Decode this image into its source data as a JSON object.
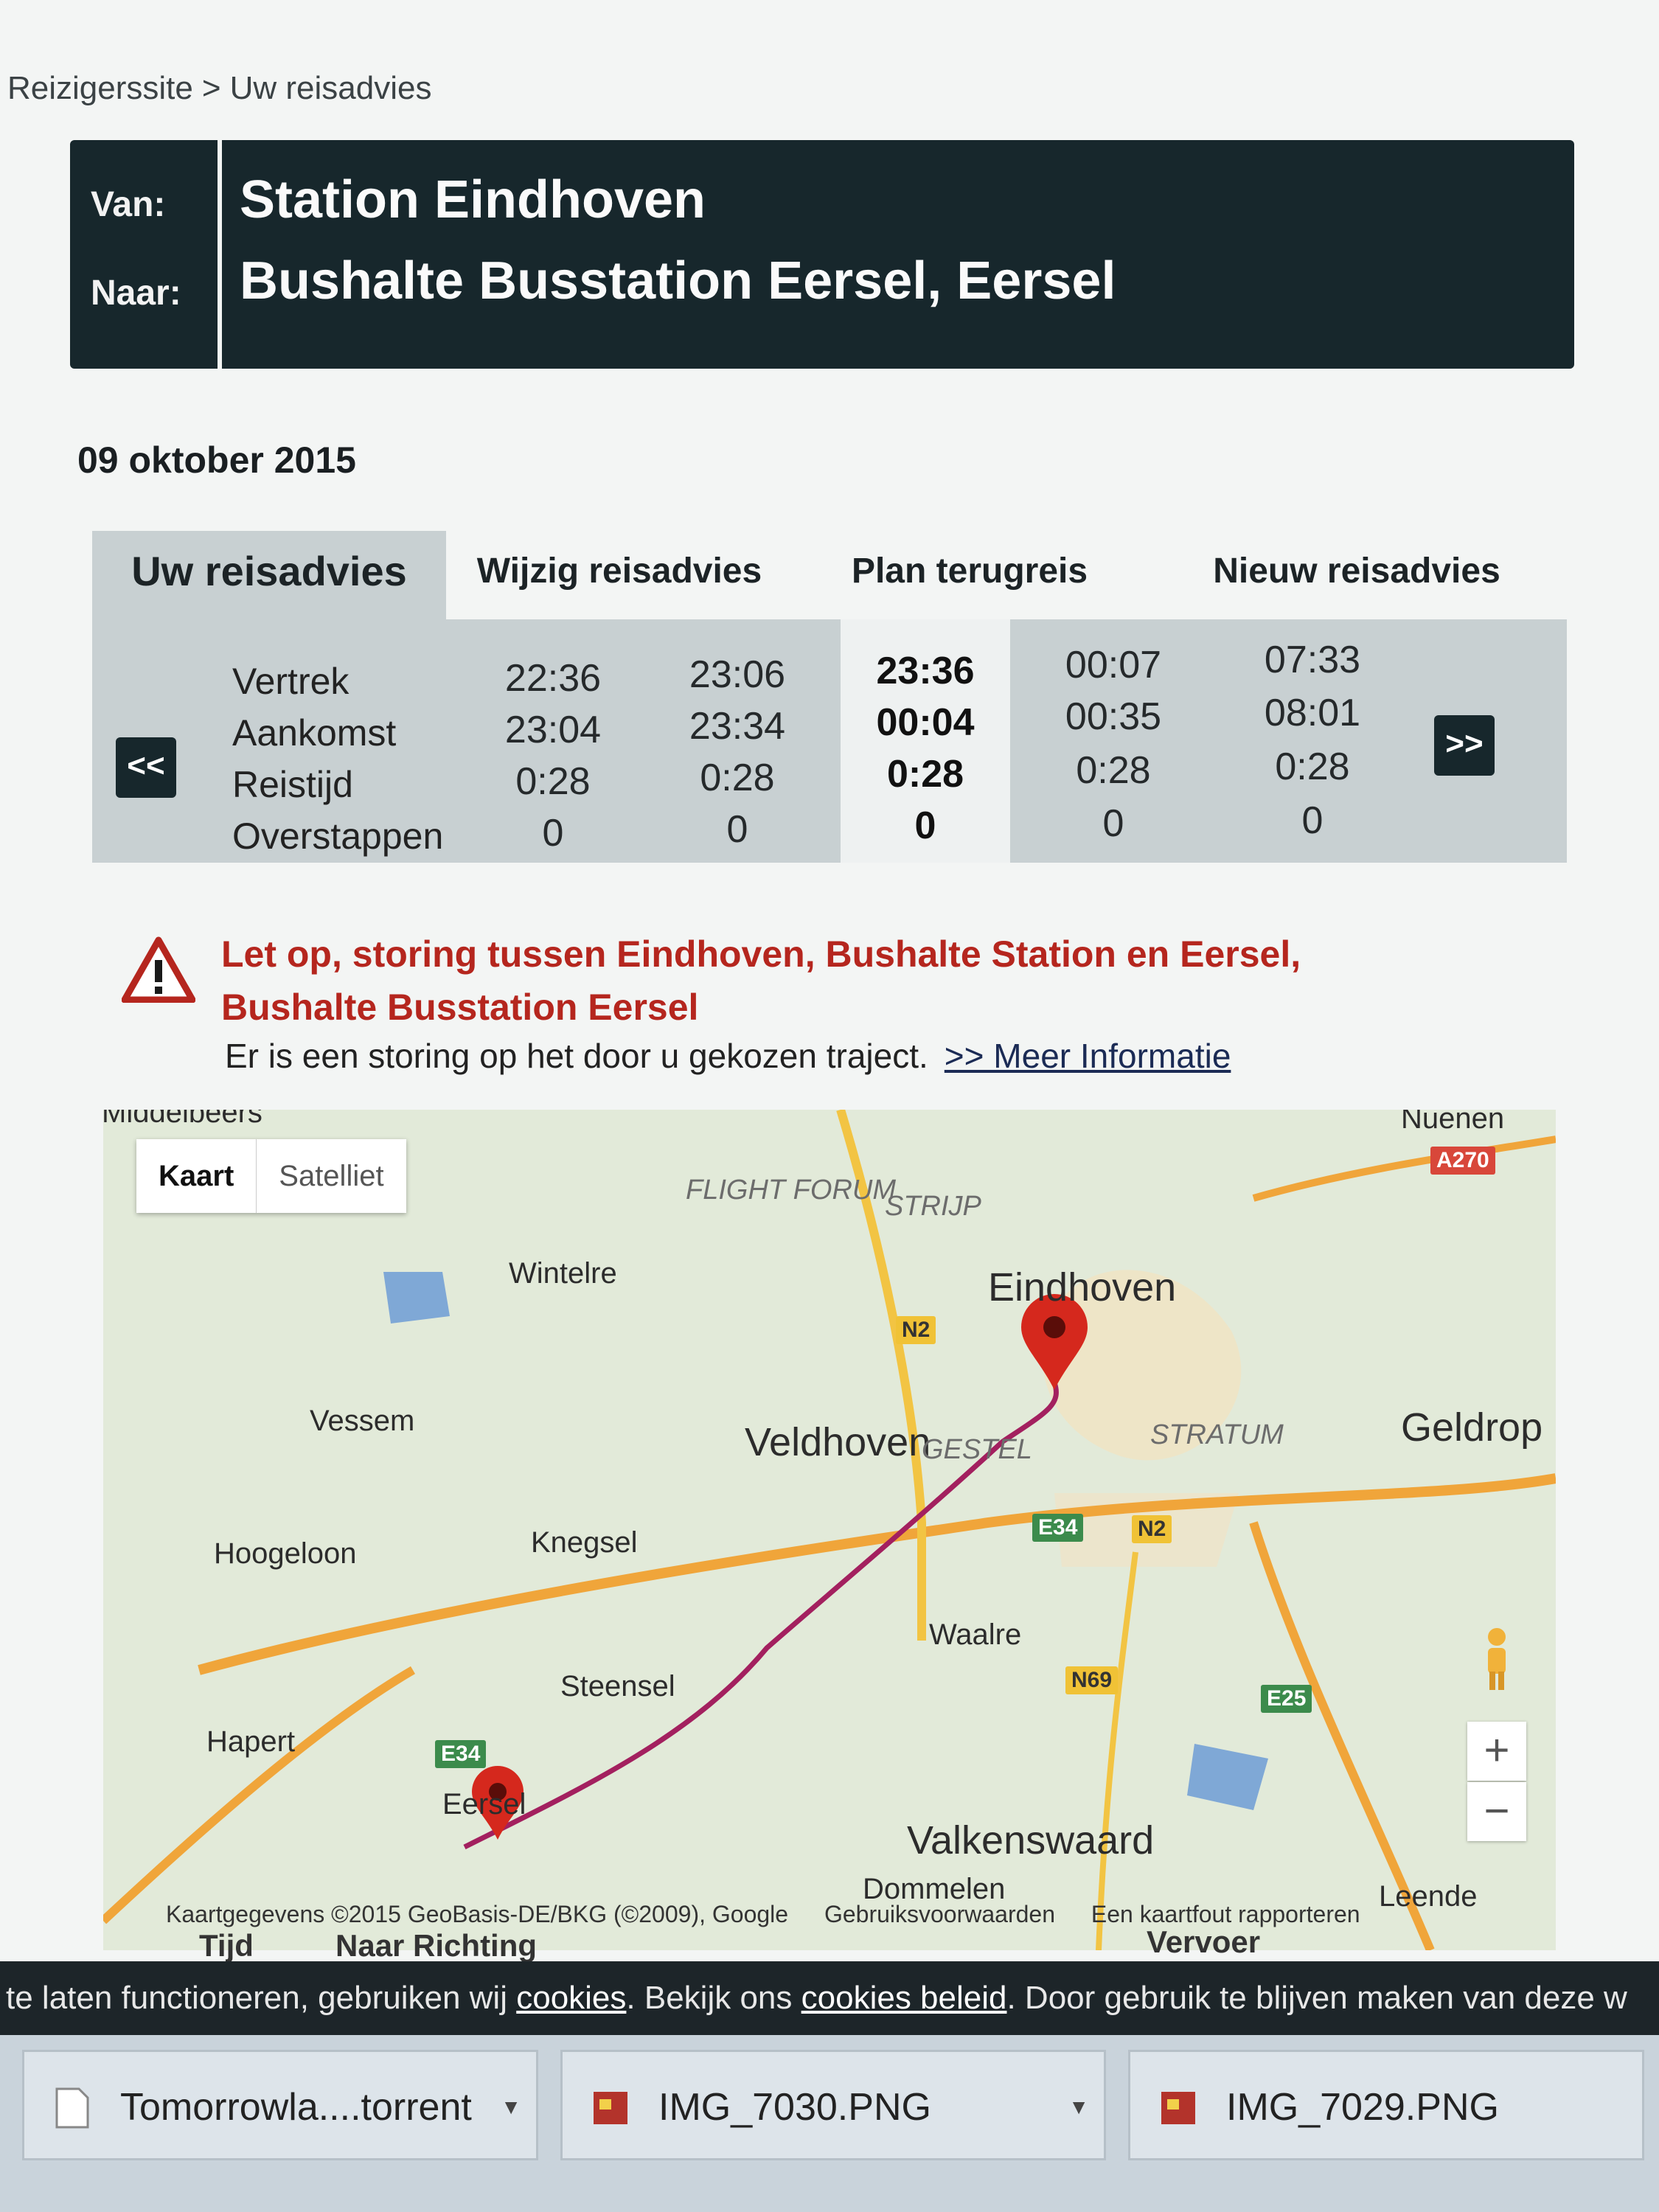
{
  "breadcrumb": {
    "home": "Reizigerssite",
    "sep": ">",
    "current": "Uw reisadvies"
  },
  "route": {
    "van_label": "Van:",
    "naar_label": "Naar:",
    "van": "Station Eindhoven",
    "naar": "Bushalte Busstation Eersel, Eersel"
  },
  "date": "09 oktober 2015",
  "tabs": [
    "Uw reisadvies",
    "Wijzig reisadvies",
    "Plan terugreis",
    "Nieuw reisadvies"
  ],
  "grid": {
    "row_labels": [
      "Vertrek",
      "Aankomst",
      "Reistijd",
      "Overstappen"
    ],
    "prev_label": "<<",
    "next_label": ">>",
    "columns": [
      {
        "vertrek": "22:36",
        "aankomst": "23:04",
        "reistijd": "0:28",
        "overstappen": "0"
      },
      {
        "vertrek": "23:06",
        "aankomst": "23:34",
        "reistijd": "0:28",
        "overstappen": "0"
      },
      {
        "vertrek": "23:36",
        "aankomst": "00:04",
        "reistijd": "0:28",
        "overstappen": "0"
      },
      {
        "vertrek": "00:07",
        "aankomst": "00:35",
        "reistijd": "0:28",
        "overstappen": "0"
      },
      {
        "vertrek": "07:33",
        "aankomst": "08:01",
        "reistijd": "0:28",
        "overstappen": "0"
      }
    ],
    "selected_index": 2
  },
  "alert": {
    "title_line1": "Let op, storing tussen Eindhoven, Bushalte Station en Eersel,",
    "title_line2": "Bushalte Busstation Eersel",
    "body": "Er is een storing op het door u gekozen traject.",
    "link": ">> Meer Informatie",
    "color": "#b5261e"
  },
  "map": {
    "toggle": {
      "kaart": "Kaart",
      "satelliet": "Satelliet"
    },
    "places": {
      "eindhoven": "Eindhoven",
      "veldhoven": "Veldhoven",
      "geldrop": "Geldrop",
      "wintelre": "Wintelre",
      "vessem": "Vessem",
      "hoogeloon": "Hoogeloon",
      "knegsel": "Knegsel",
      "steensel": "Steensel",
      "hapert": "Hapert",
      "eersel": "Eersel",
      "waalre": "Waalre",
      "valkenswaard": "Valkenswaard",
      "dommelen": "Dommelen",
      "leende": "Leende",
      "nuenen": "Nuenen",
      "middelbeers": "Middelbeers"
    },
    "districts": {
      "flight_forum": "FLIGHT FORUM",
      "strijp": "STRIJP",
      "stratum": "STRATUM",
      "gestel": "GESTEL"
    },
    "shields": {
      "n2": "N2",
      "n2b": "N2",
      "e34": "E34",
      "e34b": "E34",
      "n69": "N69",
      "e25": "E25",
      "a270": "A270"
    },
    "zoom_in": "+",
    "zoom_out": "−",
    "attribution": "Kaartgegevens ©2015 GeoBasis-DE/BKG (©2009), Google",
    "terms": "Gebruiksvoorwaarden",
    "report": "Een kaartfout rapporteren",
    "route_color": "#a3205f"
  },
  "below_map": {
    "tijd": "Tijd",
    "naar_richting": "Naar Richting",
    "vervoer": "Vervoer"
  },
  "cookie_bar": {
    "pre": "te laten functioneren, gebruiken wij ",
    "cookies": "cookies",
    "mid": ". Bekijk ons ",
    "beleid": "cookies beleid",
    "post": ". Door gebruik te blijven maken van deze w"
  },
  "taskbar": {
    "items": [
      "Tomorrowla....torrent",
      "IMG_7030.PNG",
      "IMG_7029.PNG"
    ]
  }
}
